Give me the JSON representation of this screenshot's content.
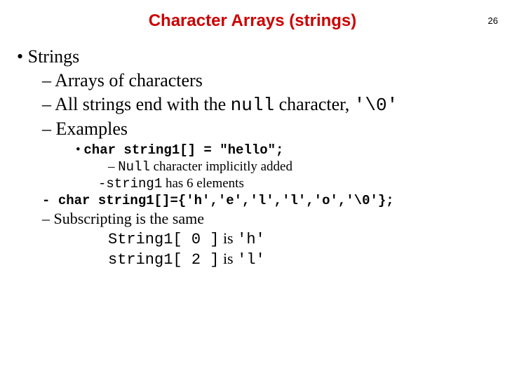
{
  "pageNumber": "26",
  "title": "Character Arrays (strings)",
  "b1": "• Strings",
  "b2a": "– Arrays of characters",
  "b2b_pre": "– All strings end with the ",
  "b2b_code": "null",
  "b2b_mid": " character, ",
  "b2b_code2": "'\\0'",
  "b2c": "– Examples",
  "b3a_pre": "• ",
  "b3a_code": "char string1[] = \"hello\";",
  "b4a_dash": "– ",
  "b4a_code": "Null",
  "b4a_rest": " character implicitly added",
  "b4b_dash": "-",
  "b4b_code": "string1",
  "b4b_rest": " has 6 elements",
  "b2d_dash": "- ",
  "b2d_code": "char string1[]={'h','e','l','l','o','\\0'};",
  "b2e": "– Subscripting is the same",
  "b4c_code": "String1[ 0 ]",
  "b4c_mid": " is ",
  "b4c_code2": "'h'",
  "b4d_code": "string1[ 2 ]",
  "b4d_mid": " is ",
  "b4d_code2": "'l'"
}
